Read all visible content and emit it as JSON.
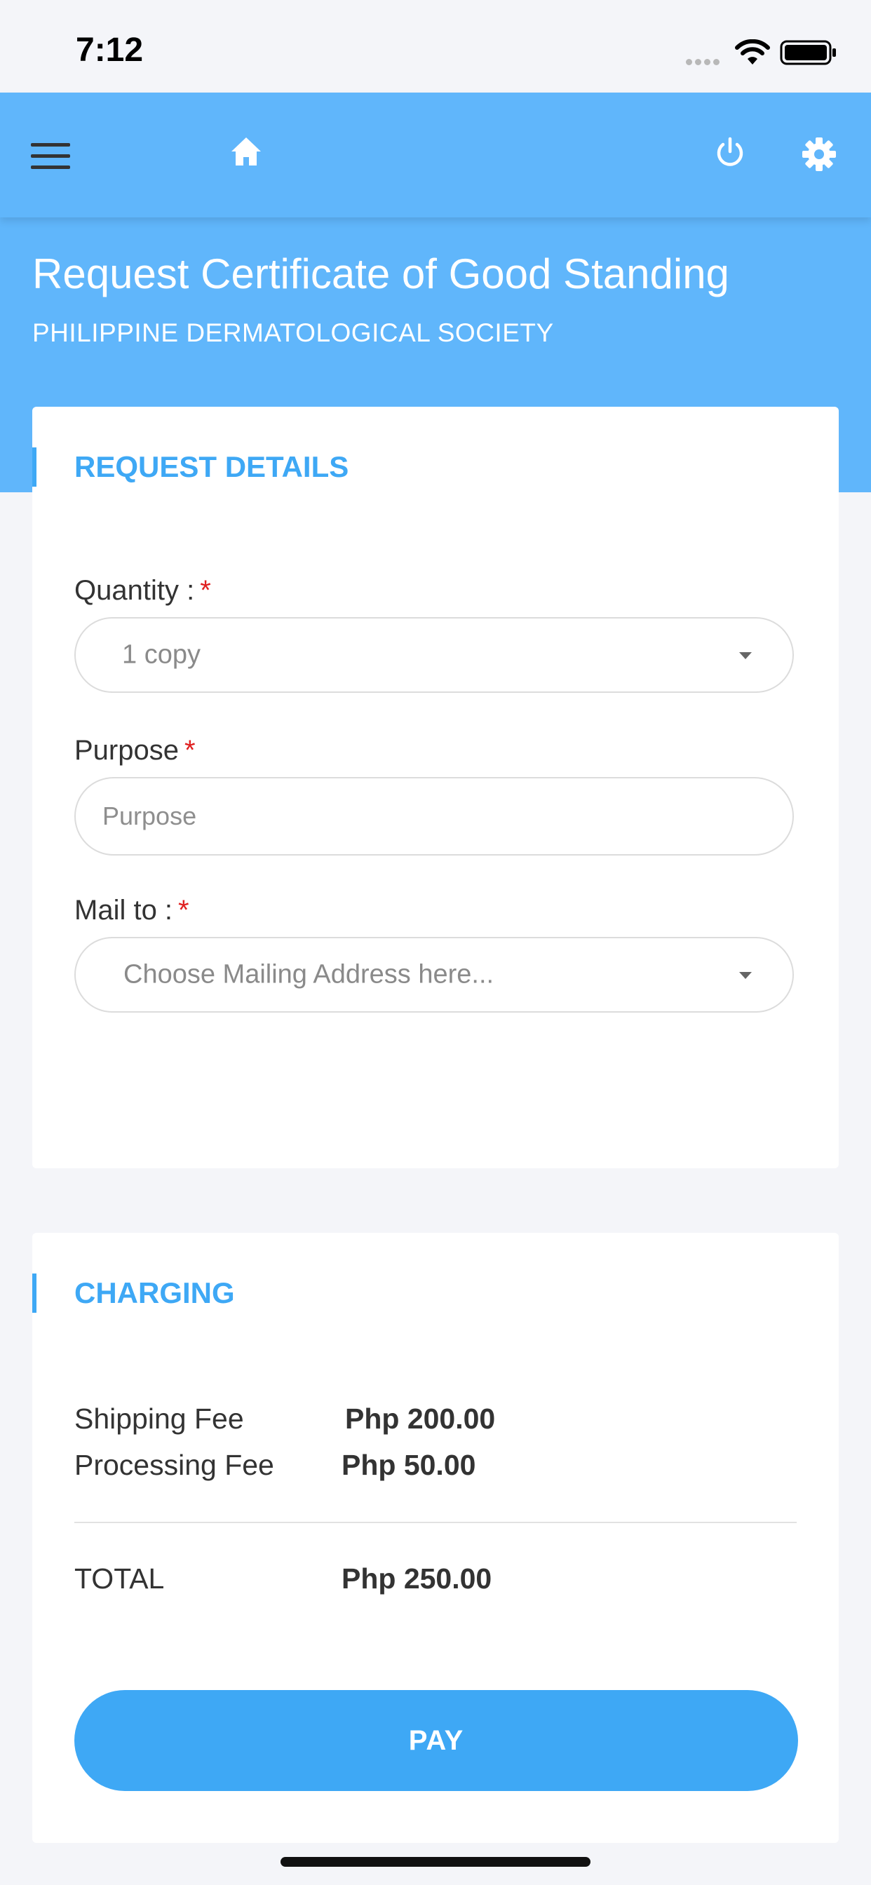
{
  "status_bar": {
    "time": "7:12"
  },
  "nav": {
    "icons": [
      "menu-icon",
      "home-icon",
      "power-icon",
      "gear-icon"
    ]
  },
  "header": {
    "title": "Request Certificate of Good Standing",
    "subtitle": "PHILIPPINE DERMATOLOGICAL SOCIETY"
  },
  "request_details": {
    "section_title": "REQUEST DETAILS",
    "quantity": {
      "label": "Quantity :",
      "required_mark": "*",
      "value": "1 copy"
    },
    "purpose": {
      "label": "Purpose",
      "required_mark": "*",
      "placeholder": "Purpose"
    },
    "mail_to": {
      "label": "Mail to :",
      "required_mark": "*",
      "placeholder": "Choose Mailing Address here..."
    }
  },
  "charging": {
    "section_title": "CHARGING",
    "shipping": {
      "label": "Shipping Fee",
      "value": "Php 200.00"
    },
    "processing": {
      "label": "Processing Fee",
      "value": "Php 50.00"
    },
    "total": {
      "label": "TOTAL",
      "value": "Php 250.00"
    },
    "pay_label": "PAY"
  },
  "colors": {
    "header_blue": "#60b6fb",
    "accent_blue": "#3ea8f5",
    "required_red": "#e02020",
    "background": "#f4f5f9"
  }
}
